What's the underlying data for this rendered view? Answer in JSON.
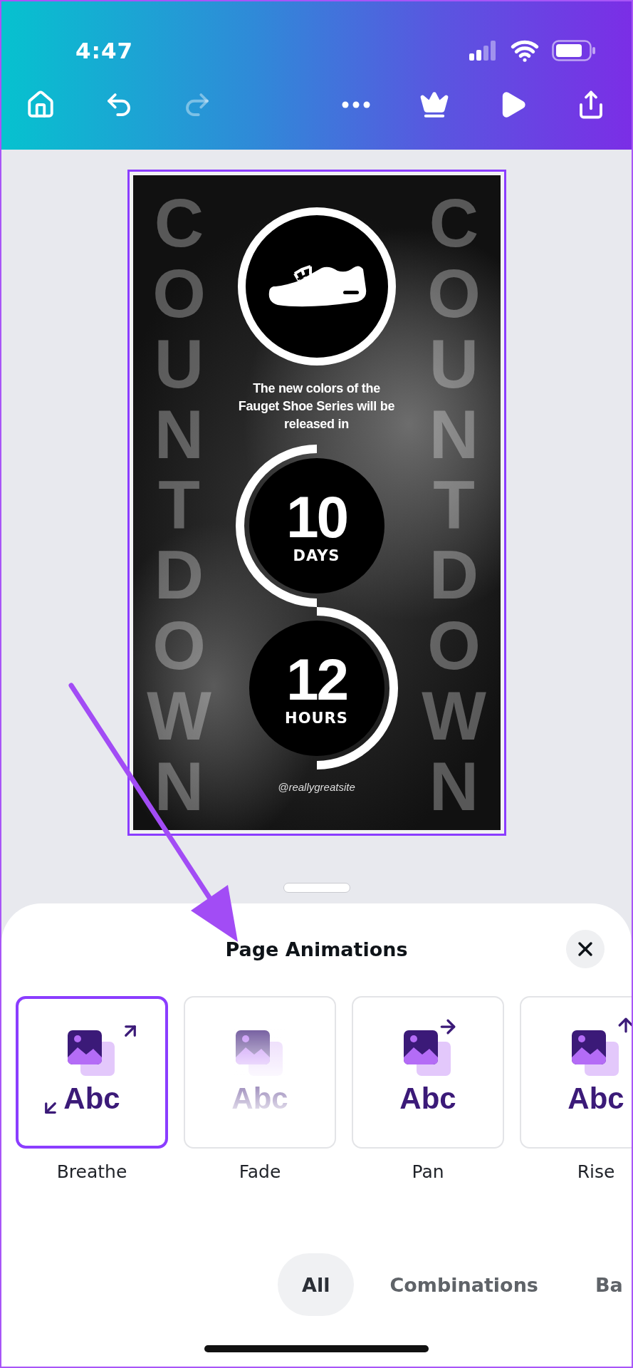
{
  "status_bar": {
    "time": "4:47"
  },
  "toolbar": [
    {
      "kind": "home",
      "disabled": false
    },
    {
      "kind": "undo",
      "disabled": false
    },
    {
      "kind": "redo",
      "disabled": true
    },
    {
      "kind": "more",
      "disabled": false
    },
    {
      "kind": "crown",
      "disabled": false
    },
    {
      "kind": "play",
      "disabled": false
    },
    {
      "kind": "share",
      "disabled": false
    }
  ],
  "design": {
    "selected": true,
    "side_text_left": "COUNTDOWN",
    "side_text_right": "COUNTDOWN",
    "message": "The new colors of the\nFauget Shoe Series will be\nreleased in",
    "countdown": [
      {
        "value": "10",
        "unit": "DAYS"
      },
      {
        "value": "12",
        "unit": "HOURS"
      }
    ],
    "handle": "@reallygreatsite"
  },
  "sheet": {
    "title": "Page Animations",
    "animations": [
      {
        "kind": "breathe",
        "label": "Breathe",
        "preview_text": "Abc",
        "selected": true
      },
      {
        "kind": "fade",
        "label": "Fade",
        "preview_text": "Abc",
        "selected": false
      },
      {
        "kind": "pan",
        "label": "Pan",
        "preview_text": "Abc",
        "selected": false
      },
      {
        "kind": "rise",
        "label": "Rise",
        "preview_text": "Abc",
        "selected": false
      }
    ],
    "filters": [
      {
        "label": "All",
        "selected": true
      },
      {
        "label": "Combinations",
        "selected": false
      },
      {
        "label": "Ba",
        "selected": false
      }
    ]
  }
}
